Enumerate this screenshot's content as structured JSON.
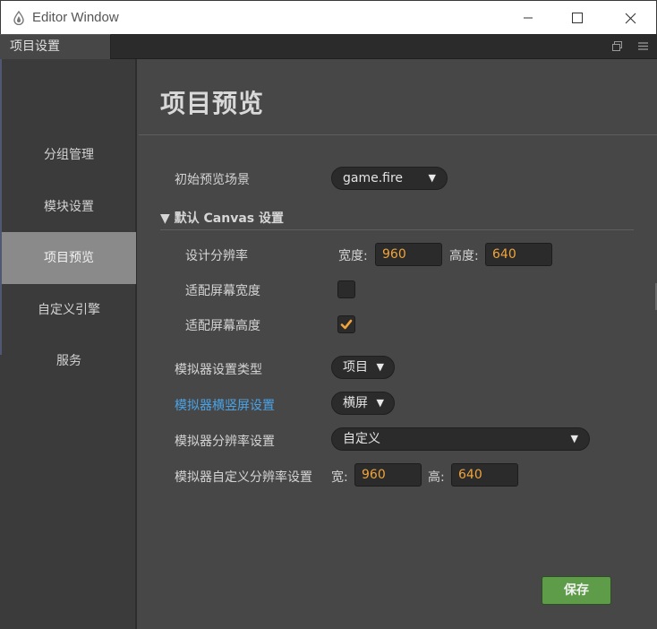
{
  "window": {
    "title": "Editor Window",
    "controls": {
      "minimize": "—",
      "maximize": "☐",
      "close": "✕"
    }
  },
  "tabs": [
    {
      "label": "项目设置"
    }
  ],
  "sidebar": {
    "items": [
      {
        "label": "分组管理",
        "active": false
      },
      {
        "label": "模块设置",
        "active": false
      },
      {
        "label": "项目预览",
        "active": true
      },
      {
        "label": "自定义引擎",
        "active": false
      },
      {
        "label": "服务",
        "active": false
      }
    ]
  },
  "main": {
    "title": "项目预览",
    "initial_scene": {
      "label": "初始预览场景",
      "value": "game.fire",
      "arrow": "▼"
    },
    "canvas_section": {
      "header": "▼ 默认 Canvas 设置",
      "design_resolution": {
        "label": "设计分辨率",
        "width_label": "宽度:",
        "width_value": "960",
        "height_label": "高度:",
        "height_value": "640"
      },
      "fit_width": {
        "label": "适配屏幕宽度",
        "checked": false
      },
      "fit_height": {
        "label": "适配屏幕高度",
        "checked": true
      }
    },
    "simulator_type": {
      "label": "模拟器设置类型",
      "value": "项目",
      "arrow": "▼"
    },
    "simulator_orientation": {
      "label": "模拟器横竖屏设置",
      "value": "横屏",
      "arrow": "▼"
    },
    "simulator_resolution": {
      "label": "模拟器分辨率设置",
      "value": "自定义",
      "arrow": "▼"
    },
    "simulator_custom_resolution": {
      "label": "模拟器自定义分辨率设置",
      "width_label": "宽:",
      "width_value": "960",
      "height_label": "高:",
      "height_value": "640"
    },
    "save_label": "保存"
  },
  "colors": {
    "accent_orange": "#f0a43a",
    "link_blue": "#4aa3e6",
    "save_green": "#5e9c49",
    "active_sidebar": "#8a8a8a"
  }
}
